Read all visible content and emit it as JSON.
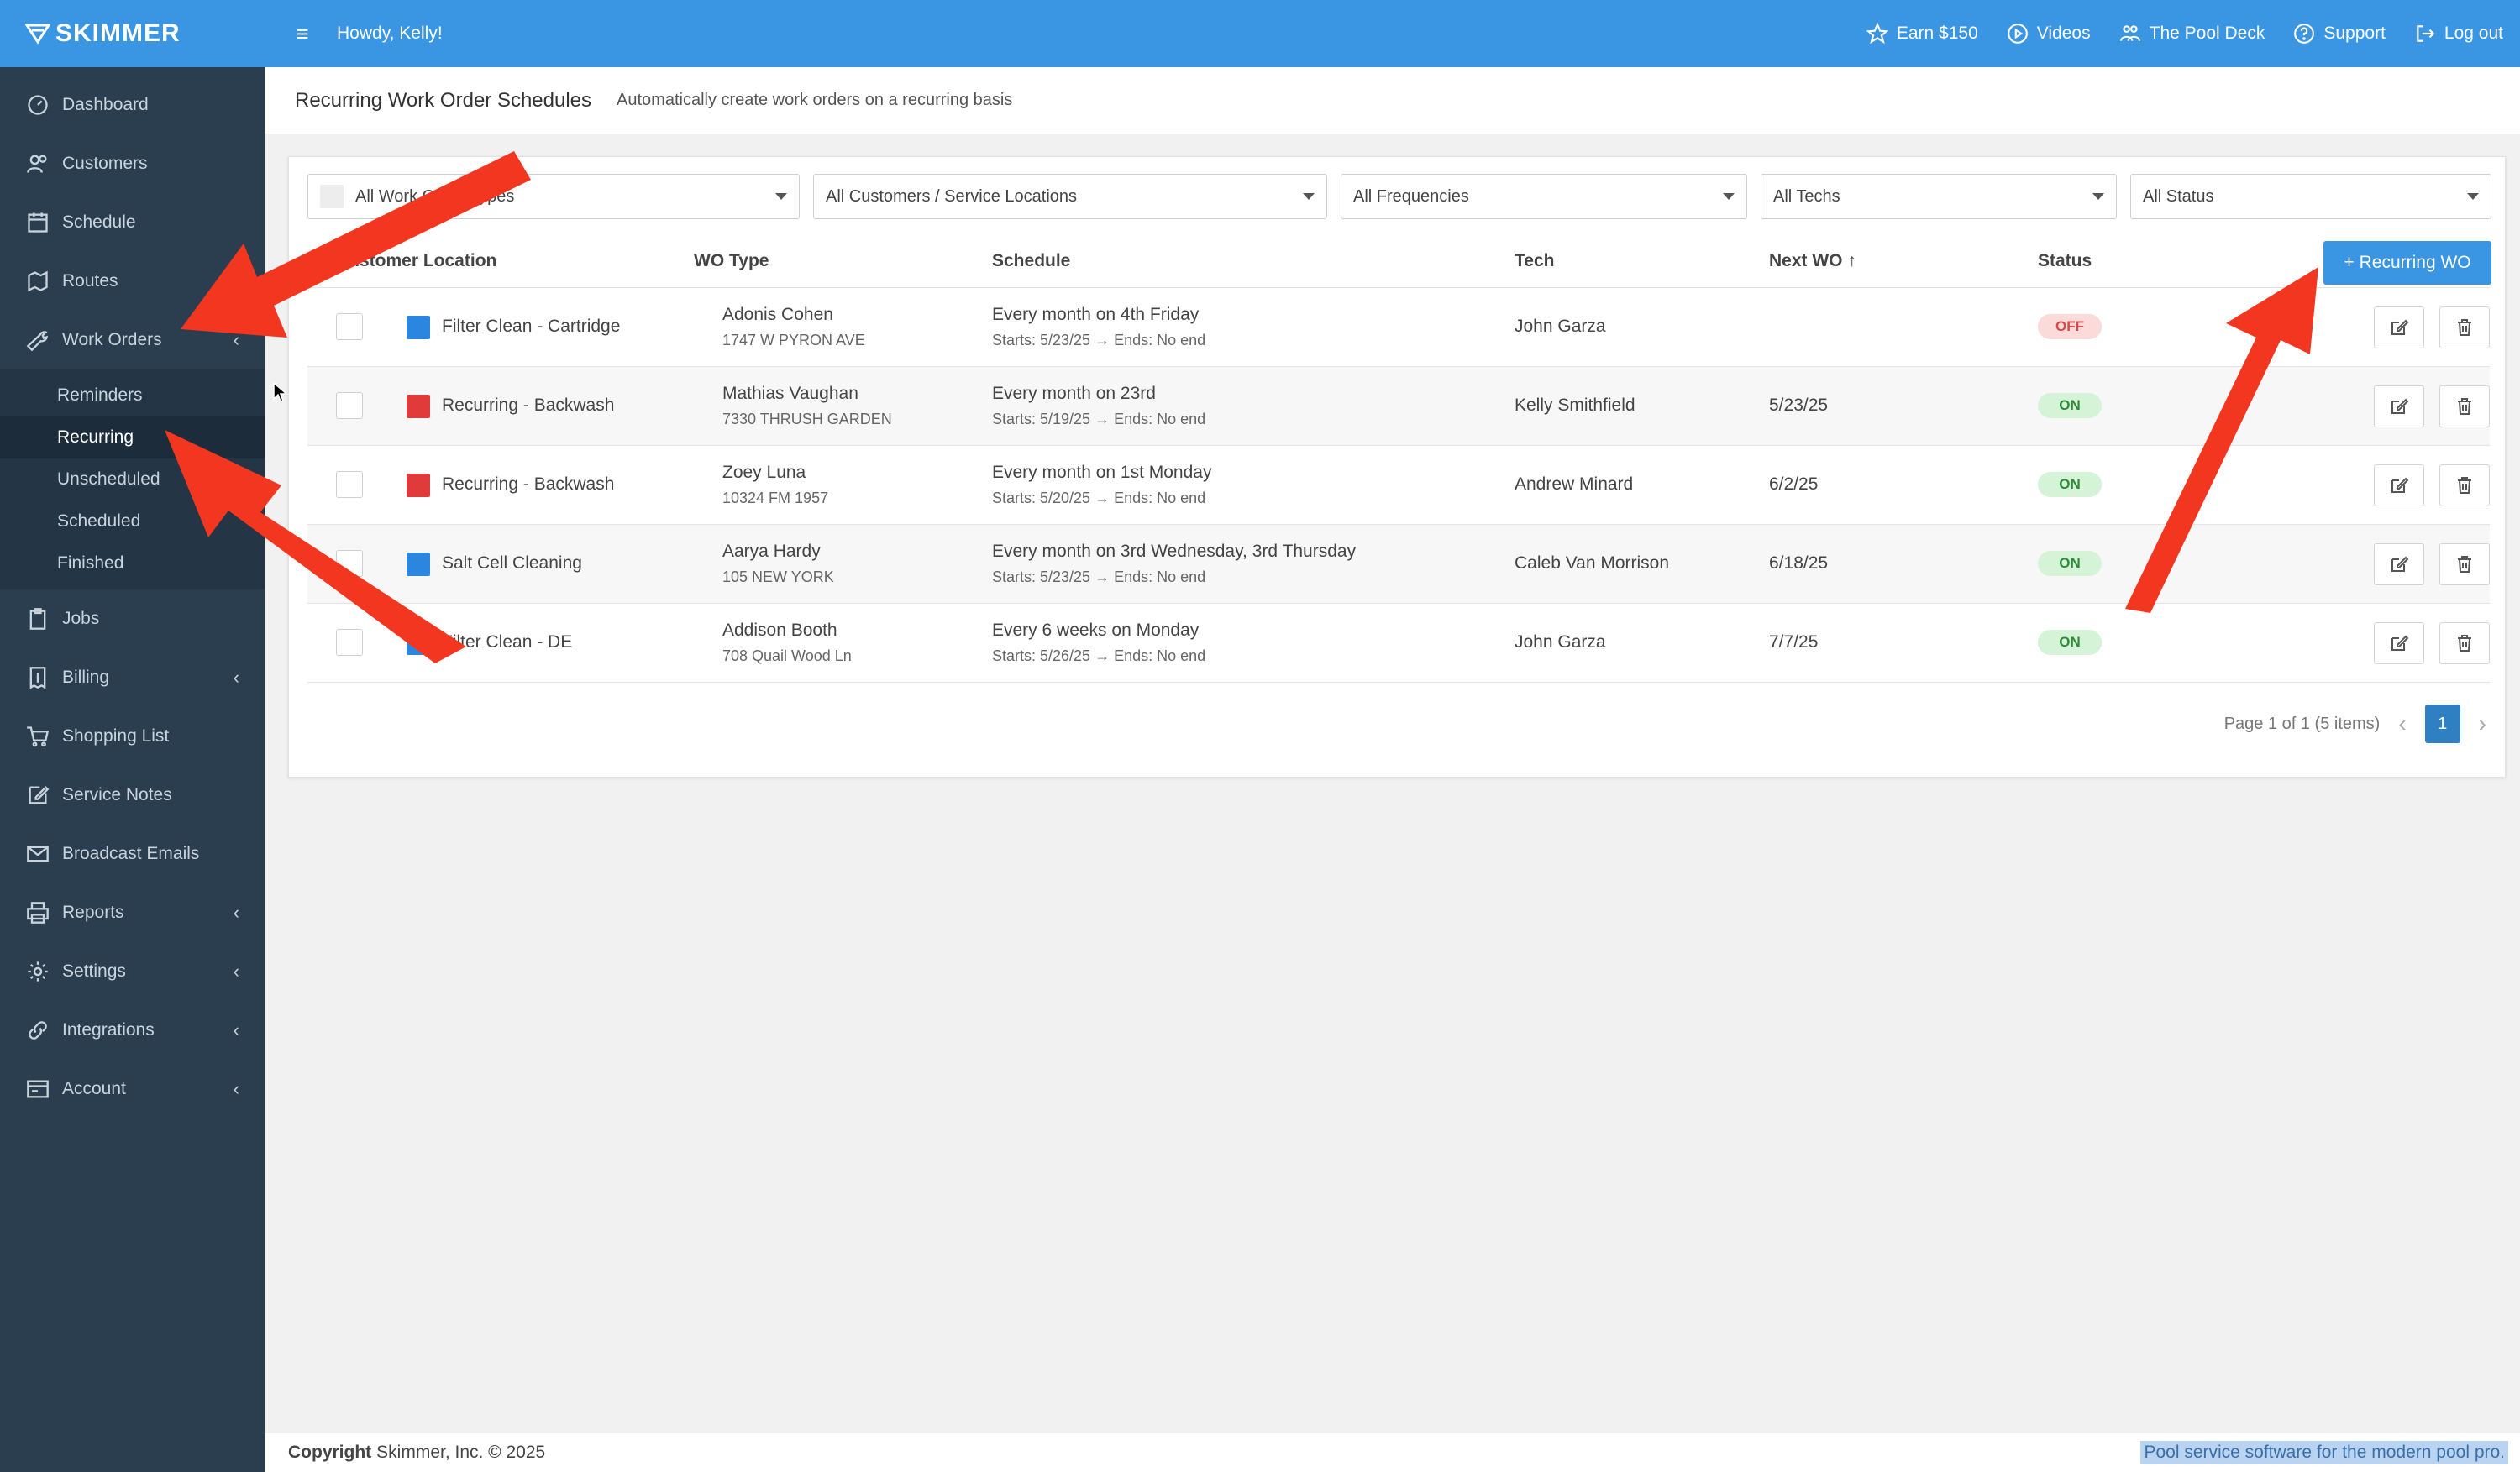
{
  "brand": "SKIMMER",
  "topbar": {
    "greeting": "Howdy, Kelly!",
    "links": [
      {
        "label": "Earn $150",
        "icon": "star-icon"
      },
      {
        "label": "Videos",
        "icon": "play-icon"
      },
      {
        "label": "The Pool Deck",
        "icon": "people-icon"
      },
      {
        "label": "Support",
        "icon": "help-icon"
      },
      {
        "label": "Log out",
        "icon": "logout-icon"
      }
    ]
  },
  "sidebar": {
    "items": [
      {
        "label": "Dashboard"
      },
      {
        "label": "Customers"
      },
      {
        "label": "Schedule"
      },
      {
        "label": "Routes"
      },
      {
        "label": "Work Orders"
      },
      {
        "label": "Jobs"
      },
      {
        "label": "Billing"
      },
      {
        "label": "Shopping List"
      },
      {
        "label": "Service Notes"
      },
      {
        "label": "Broadcast Emails"
      },
      {
        "label": "Reports"
      },
      {
        "label": "Settings"
      },
      {
        "label": "Integrations"
      },
      {
        "label": "Account"
      }
    ],
    "work_orders_sub": [
      {
        "label": "Reminders"
      },
      {
        "label": "Recurring"
      },
      {
        "label": "Unscheduled"
      },
      {
        "label": "Scheduled"
      },
      {
        "label": "Finished"
      }
    ]
  },
  "page": {
    "title": "Recurring Work Order Schedules",
    "subtitle": "Automatically create work orders on a recurring basis"
  },
  "filters": {
    "wo_types": "All Work Order Types",
    "customers": "All Customers / Service Locations",
    "frequencies": "All Frequencies",
    "techs": "All Techs",
    "status": "All Status"
  },
  "table": {
    "headers": {
      "wo_type": "WO Type",
      "customer": "Customer Location",
      "schedule": "Schedule",
      "tech": "Tech",
      "next_wo": "Next WO",
      "status": "Status"
    },
    "add_button": "Recurring WO",
    "rows": [
      {
        "wo_type": "Filter Clean - Cartridge",
        "color": "#2b86e0",
        "customer": "Adonis Cohen",
        "address": "1747 W PYRON AVE",
        "schedule": "Every month on 4th Friday",
        "starts": "Starts: 5/23/25 → Ends: No end",
        "tech": "John Garza",
        "next_wo": "",
        "status": "OFF"
      },
      {
        "wo_type": "Recurring - Backwash",
        "color": "#e03a3a",
        "customer": "Mathias Vaughan",
        "address": "7330 THRUSH GARDEN",
        "schedule": "Every month on 23rd",
        "starts": "Starts: 5/19/25 → Ends: No end",
        "tech": "Kelly Smithfield",
        "next_wo": "5/23/25",
        "status": "ON"
      },
      {
        "wo_type": "Recurring - Backwash",
        "color": "#e03a3a",
        "customer": "Zoey Luna",
        "address": "10324 FM 1957",
        "schedule": "Every month on 1st Monday",
        "starts": "Starts: 5/20/25 → Ends: No end",
        "tech": "Andrew Minard",
        "next_wo": "6/2/25",
        "status": "ON"
      },
      {
        "wo_type": "Salt Cell Cleaning",
        "color": "#2b86e0",
        "customer": "Aarya Hardy",
        "address": "105 NEW YORK",
        "schedule": "Every month on 3rd Wednesday, 3rd Thursday",
        "starts": "Starts: 5/23/25 → Ends: No end",
        "tech": "Caleb Van Morrison",
        "next_wo": "6/18/25",
        "status": "ON"
      },
      {
        "wo_type": "Filter Clean - DE",
        "color": "#2b86e0",
        "customer": "Addison Booth",
        "address": "708 Quail Wood Ln",
        "schedule": "Every 6 weeks on Monday",
        "starts": "Starts: 5/26/25 → Ends: No end",
        "tech": "John Garza",
        "next_wo": "7/7/25",
        "status": "ON"
      }
    ]
  },
  "pager": {
    "summary": "Page 1 of 1 (5 items)",
    "current": "1"
  },
  "footer": {
    "copyright_label": "Copyright",
    "copyright_text": "Skimmer, Inc. © 2025",
    "tagline": "Pool service software for the modern pool pro."
  },
  "colors": {
    "brand_blue": "#3a95e2",
    "sidebar": "#2b3e50",
    "annotation_arrow": "#f2361f"
  }
}
